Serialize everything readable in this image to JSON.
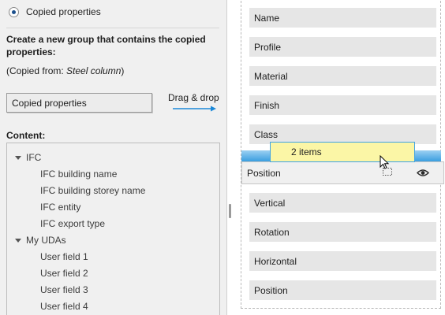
{
  "left": {
    "radio_label": "Copied properties",
    "description": "Create a new group that contains the copied properties:",
    "copied_from_prefix": "(Copied from: ",
    "copied_from_value": "Steel column",
    "copied_from_suffix": ")",
    "group_name_value": "Copied properties",
    "drag_drop_label": "Drag & drop",
    "content_label": "Content:",
    "tree": [
      {
        "label": "IFC",
        "level": 0,
        "expanded": true
      },
      {
        "label": "IFC building name",
        "level": 1
      },
      {
        "label": "IFC building storey name",
        "level": 1
      },
      {
        "label": "IFC entity",
        "level": 1
      },
      {
        "label": "IFC export type",
        "level": 1
      },
      {
        "label": "My UDAs",
        "level": 0,
        "expanded": true
      },
      {
        "label": "User field 1",
        "level": 1
      },
      {
        "label": "User field 2",
        "level": 1
      },
      {
        "label": "User field 3",
        "level": 1
      },
      {
        "label": "User field 4",
        "level": 1
      }
    ]
  },
  "right": {
    "items_top": [
      "Name",
      "Profile",
      "Material",
      "Finish",
      "Class"
    ],
    "dragged_row_label": "Position",
    "items_bottom": [
      "Vertical",
      "Rotation",
      "Horizontal",
      "Position"
    ],
    "drag_tooltip": "2 items"
  },
  "icons": {
    "radio": "radio-selected-icon",
    "arrow": "arrow-right-icon",
    "caret": "caret-down-icon",
    "eye": "eye-icon",
    "cursor": "drag-cursor-icon"
  },
  "colors": {
    "accent": "#1b88d8",
    "drop_indicator": "#3a9ee0",
    "tooltip_bg": "#fbf6a6"
  }
}
